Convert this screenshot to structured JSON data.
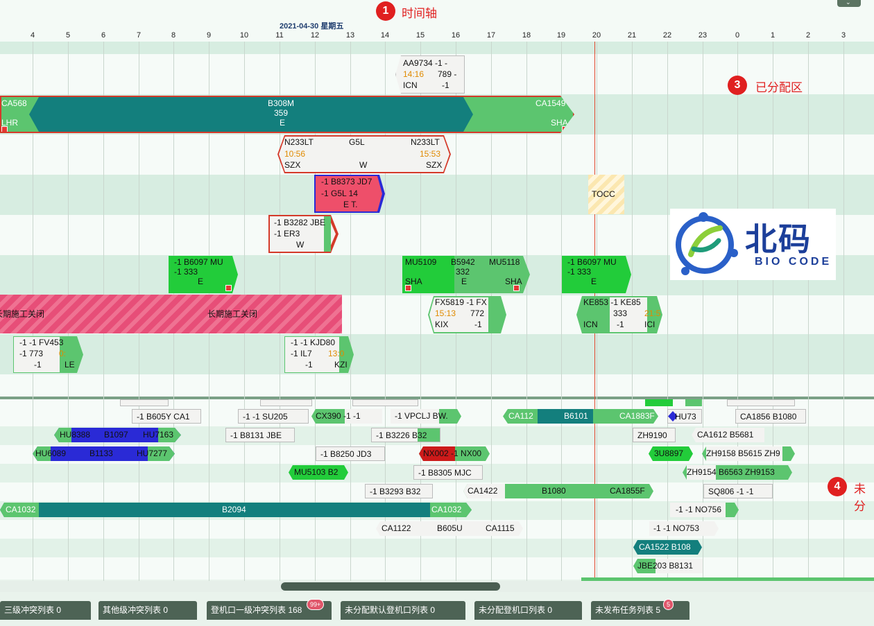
{
  "header": {
    "date": "2021-04-30 星期五",
    "ticks": [
      "4",
      "5",
      "6",
      "7",
      "8",
      "9",
      "10",
      "11",
      "12",
      "13",
      "14",
      "15",
      "16",
      "17",
      "18",
      "19",
      "20",
      "21",
      "22",
      "23",
      "0",
      "1",
      "2",
      "3"
    ]
  },
  "markers": [
    {
      "num": "1",
      "label": "时间轴"
    },
    {
      "num": "3",
      "label": "已分配区"
    },
    {
      "num": "4",
      "label": "未分"
    }
  ],
  "logo": {
    "cn": "北码",
    "en": "BIO CODE"
  },
  "assigned": {
    "aa9734": {
      "l1": "AA9734  -1  -",
      "t": "14:16",
      "v": "789 -",
      "l3a": "ICN",
      "l3b": "-1"
    },
    "b308m": {
      "left_code": "CA568",
      "left_port": "LHR",
      "mid1": "B308M",
      "mid2": "359",
      "mid3": "E",
      "right_code": "CA1549",
      "right_port": "SHA"
    },
    "n233lt": {
      "a": "N233LT",
      "b": "G5L",
      "c": "N233LT",
      "t1": "10:56",
      "t2": "15:53",
      "p1": "SZX",
      "p2": "W",
      "p3": "SZX"
    },
    "b8373": {
      "l1": "-1  B8373  JD7",
      "l2": "-1    G5L     14",
      "l3": "E        T."
    },
    "b3282": {
      "l1": "-1  B3282  JBE",
      "l2": "-1    ER3",
      "l3": "W"
    },
    "b6097a": {
      "l1": "-1  B6097  MU",
      "l2": "-1    333",
      "l3": "E"
    },
    "b5942": {
      "a": "MU5109",
      "b": "B5942",
      "c": "MU5118",
      "p1": "SHA",
      "p2": "332",
      "p3": "SHA",
      "p4": "E"
    },
    "b6097b": {
      "l1": "-1  B6097  MU",
      "l2": "-1    333",
      "l3": "E"
    },
    "fx5819": {
      "l1": "FX5819  -1   FX",
      "t": "15:13",
      "v": "772",
      "l3a": "KIX",
      "l3b": "-1"
    },
    "ke853": {
      "l1": "KE853  -1   KE85",
      "t": "21:5",
      "v": "333",
      "l3a": "ICN",
      "l3b": "-1",
      "l3c": "ICI"
    },
    "tocc": "TOCC",
    "closed1": "长期施工关闭",
    "closed2": "长期施工关闭",
    "fv453": {
      "l1": "-1   -1   FV453",
      "l2": "-1  773",
      "t": "0:",
      "l3a": "-1",
      "l3b": "LE"
    },
    "kjd80": {
      "l1": "-1   -1   KJD80",
      "l2": "-1  IL7",
      "t": "13:0",
      "l3a": "-1",
      "l3b": "KZI"
    }
  },
  "unassigned": [
    [
      "-1  B605Y CA1",
      "-1   -1    SU205",
      "CX390   -1   -1",
      "-1  VPCLJ BW.",
      "CA112",
      "B6101",
      "CA1883F",
      "HU73",
      "CA1856  B1080"
    ],
    [
      "HU8388",
      "B1097",
      "HU7163",
      "-1  B8131  JBE",
      "-1  B3226  B32",
      "ZH9190",
      "CA1612  B5681"
    ],
    [
      "HU6089",
      "B1133",
      "HU7277",
      "-1  B8250  JD3",
      "NX002  -1  NX00",
      "3U8897",
      "ZH9158  B5615  ZH9"
    ],
    [
      "MU5103  B2",
      "-1  B8305  MJC",
      "ZH9154   B6563   ZH9153"
    ],
    [
      "-1  B3293  B32",
      "CA1422",
      "B1080",
      "CA1855F",
      "SQ806   -1   -1"
    ],
    [
      "CA1032",
      "B2094",
      "CA1032",
      "-1   -1   NO756"
    ],
    [
      "CA1122",
      "B605U",
      "CA1115",
      "-1   -1   NO753"
    ],
    [
      "CA1522  B108"
    ],
    [
      "JBE203  B8131"
    ]
  ],
  "tabs": [
    {
      "label": "三级冲突列表 0"
    },
    {
      "label": "其他级冲突列表 0"
    },
    {
      "label": "登机口一级冲突列表 168",
      "badge": "99+"
    },
    {
      "label": "未分配默认登机口列表 0"
    },
    {
      "label": "未分配登机口列表 0"
    },
    {
      "label": "未发布任务列表 5",
      "badge": "5"
    }
  ],
  "colors": {
    "teal": "#137f7d",
    "green": "#5cc56f",
    "bright_green": "#22cc3a",
    "blue": "#3a1ed6",
    "red_fill": "#ee4f6a",
    "white_block": "#f3f3f1",
    "border_red": "#d43a2a",
    "time_orange": "#e08a00",
    "now_line": "#e0482f"
  }
}
